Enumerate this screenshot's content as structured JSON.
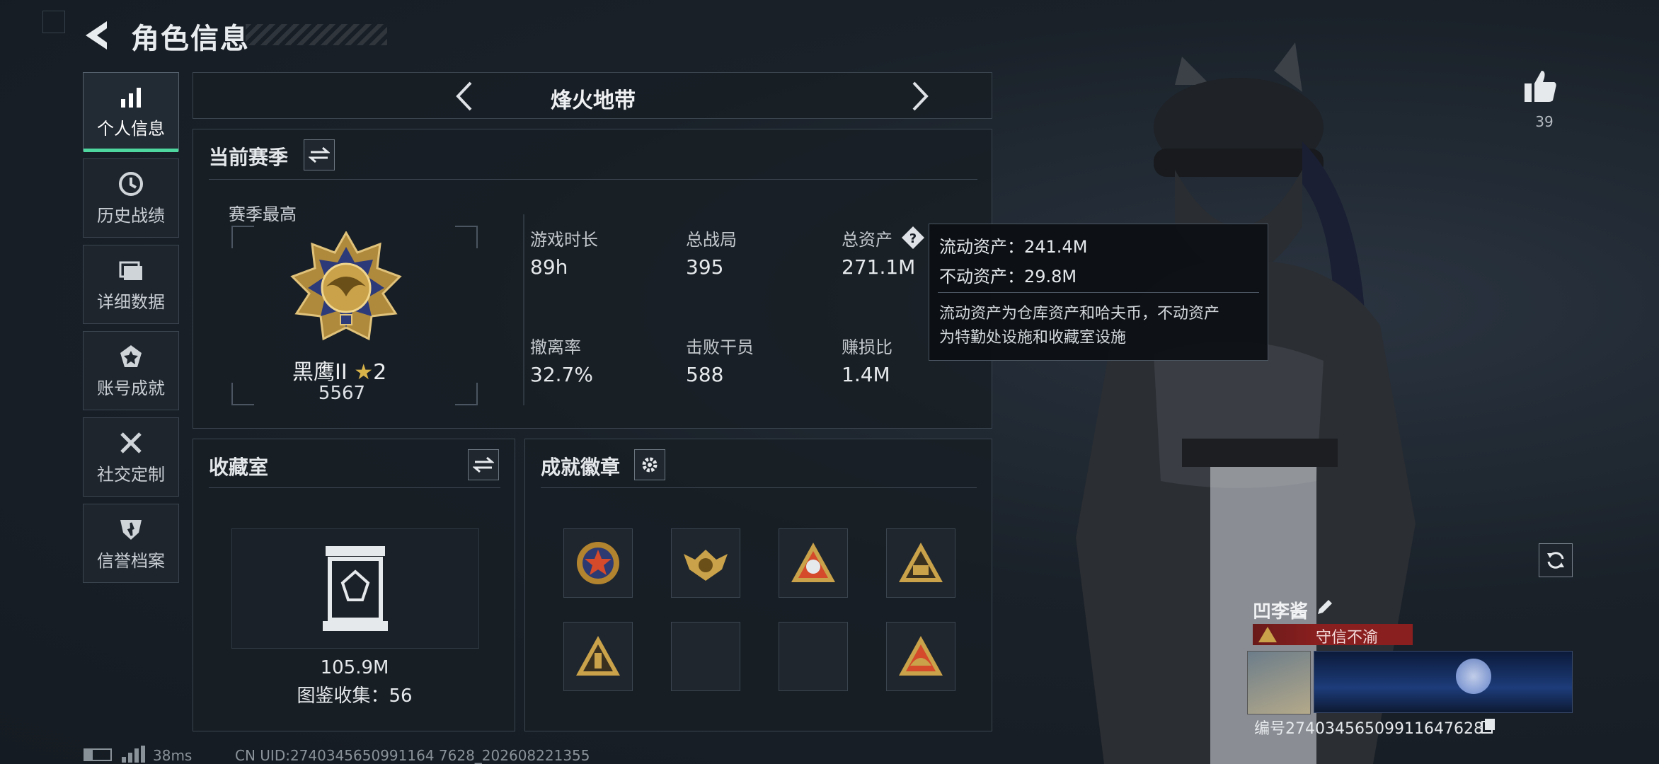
{
  "header": {
    "title": "角色信息"
  },
  "nav": [
    {
      "label": "个人信息",
      "icon": "bar-chart-icon",
      "active": true
    },
    {
      "label": "历史战绩",
      "icon": "history-icon"
    },
    {
      "label": "详细数据",
      "icon": "folder-icon"
    },
    {
      "label": "账号成就",
      "icon": "achievement-icon"
    },
    {
      "label": "社交定制",
      "icon": "tools-icon"
    },
    {
      "label": "信誉档案",
      "icon": "reputation-icon"
    }
  ],
  "mode_selector": {
    "label": "烽火地带"
  },
  "season": {
    "title": "当前赛季",
    "best_label": "赛季最高",
    "rank_name": "黑鹰II",
    "rank_stars": "2",
    "rank_score": "5567",
    "stats": [
      {
        "label": "游戏时长",
        "value": "89h"
      },
      {
        "label": "总战局",
        "value": "395"
      },
      {
        "label": "总资产",
        "value": "271.1M"
      },
      {
        "label": "撤离率",
        "value": "32.7%"
      },
      {
        "label": "击败干员",
        "value": "588"
      },
      {
        "label": "赚损比",
        "value": "1.4M"
      }
    ]
  },
  "tooltip": {
    "liquid": "流动资产：241.4M",
    "fixed": "不动资产：29.8M",
    "desc_line1": "流动资产为仓库资产和哈夫币，不动资产",
    "desc_line2": "为特勤处设施和收藏室设施"
  },
  "collection": {
    "title": "收藏室",
    "value": "105.9M",
    "count_text": "图鉴收集：56"
  },
  "badges": {
    "title": "成就徽章"
  },
  "likes": {
    "count": "39"
  },
  "player": {
    "name": "凹李酱",
    "title_badge": "守信不渝",
    "id_text": "编号2740345650991164762​8"
  },
  "footer": {
    "ping": "38ms",
    "uid": "CN UID:2740345650991164 7628_202608221355"
  },
  "colors": {
    "accent": "#4fd7a0",
    "title_badge_bg": "#8a1f1f",
    "gold": "#c9a24a"
  }
}
